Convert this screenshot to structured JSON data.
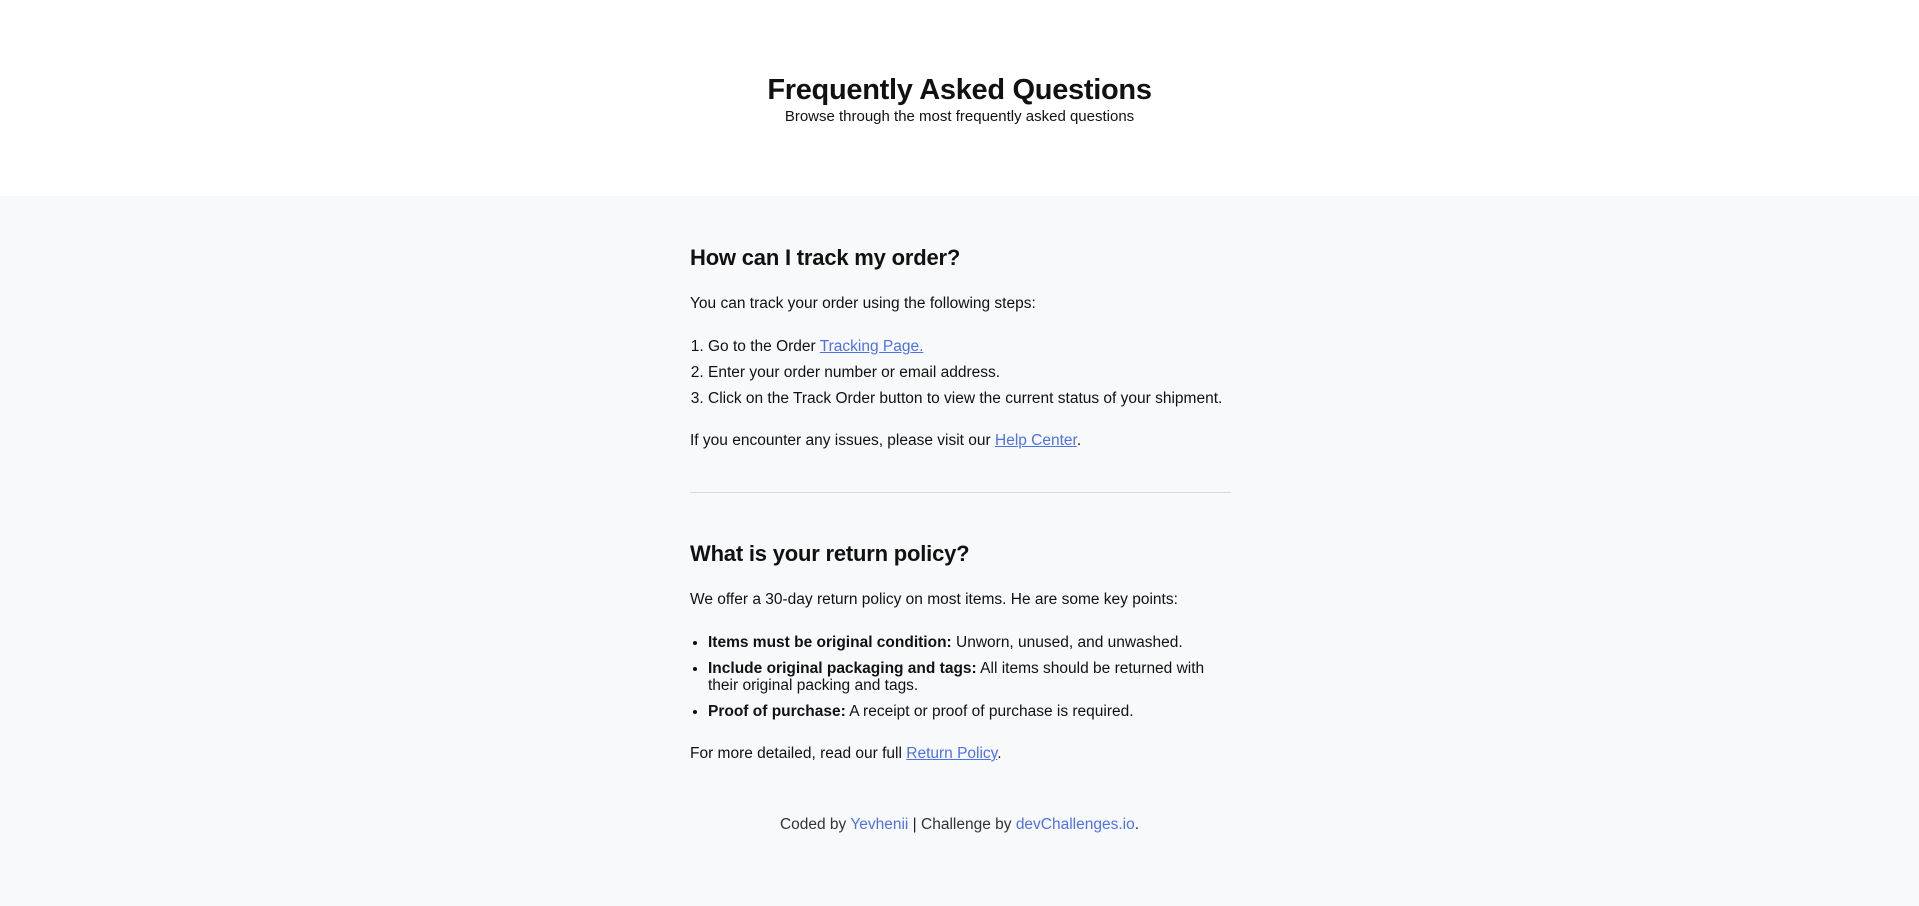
{
  "header": {
    "title": "Frequently Asked Questions",
    "subtitle": "Browse through the most frequently asked questions"
  },
  "faq1": {
    "question": "How can I track my order?",
    "intro": "You can track your order using the following steps:",
    "steps": [
      {
        "before": "Go to the Order ",
        "link": "Tracking Page."
      },
      {
        "text": "Enter your order number or email address."
      },
      {
        "text": "Click on the Track Order button to view the current status of your shipment."
      }
    ],
    "outro_before": "If you encounter any issues, please visit our ",
    "outro_link": "Help Center",
    "outro_after": "."
  },
  "faq2": {
    "question": "What is your return policy?",
    "intro": "We offer a 30-day return policy on most items. He are some key points:",
    "points": [
      {
        "bold": "Items must be original condition:",
        "text": " Unworn, unused, and unwashed."
      },
      {
        "bold": "Include original packaging and tags:",
        "text": " All items should be returned with their original packing and tags."
      },
      {
        "bold": "Proof of purchase:",
        "text": " A receipt or proof of purchase is required."
      }
    ],
    "outro_before": "For more detailed, read our full ",
    "outro_link": "Return Policy",
    "outro_after": "."
  },
  "footer": {
    "coded_by": "Coded by ",
    "author": "Yevhenii",
    "separator": " | ",
    "challenge_by": "Challenge by ",
    "challenge_link": "devChallenges.io",
    "end": "."
  },
  "colors": {
    "link": "#4e71e8",
    "background": "#f8f9fa",
    "hero_background": "#ffffff"
  }
}
